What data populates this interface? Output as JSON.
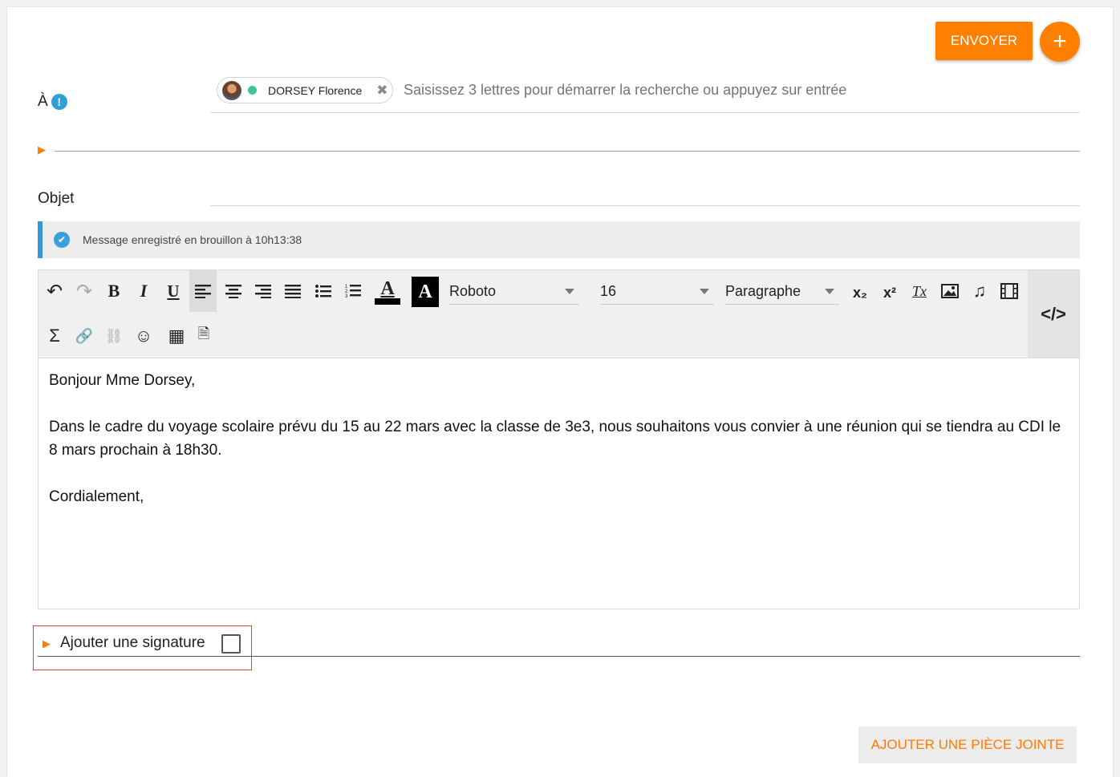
{
  "header": {
    "send_label": "ENVOYER",
    "add_label": "+"
  },
  "to": {
    "label": "À",
    "info_icon": "!",
    "recipient_name": "DORSEY Florence",
    "recipient_status_color": "#3cc5a0",
    "remove_icon": "✖",
    "placeholder": "Saisissez 3 lettres pour démarrer la recherche ou appuyez sur entrée"
  },
  "cc_toggle": "▶",
  "subject": {
    "label": "Objet"
  },
  "notice": {
    "text": "Message enregistré en brouillon à 10h13:38",
    "icon": "✔"
  },
  "toolbar": {
    "undo": "↶",
    "redo": "↷",
    "bold": "B",
    "italic": "I",
    "underline": "U",
    "font_color": "A",
    "bg_color": "A",
    "font_family": "Roboto",
    "font_size": "16",
    "block_format": "Paragraphe",
    "subscript": "x₂",
    "superscript": "x²",
    "clear_format": "Tx",
    "image": "🖼",
    "audio": "♫",
    "video": "🎞",
    "code": "</>",
    "formula": "Σ",
    "link": "🔗",
    "unlink": "⛓",
    "emoji": "☺",
    "table": "▦",
    "template": "🗎"
  },
  "editor": {
    "paragraphs": [
      "Bonjour Mme Dorsey,",
      "Dans le cadre du voyage scolaire prévu du 15 au 22 mars avec la classe de 3e3, nous souhaitons vous convier à une réunion qui se tiendra au CDI le 8 mars prochain à 18h30.",
      "Cordialement,"
    ]
  },
  "signature": {
    "toggle": "▶",
    "label": "Ajouter une signature",
    "checked": false
  },
  "footer": {
    "attach_label": "AJOUTER UNE PIÈCE JOINTE"
  },
  "colors": {
    "accent": "#ff8000",
    "info": "#2f9fd8",
    "highlight_box": "#e53935"
  }
}
